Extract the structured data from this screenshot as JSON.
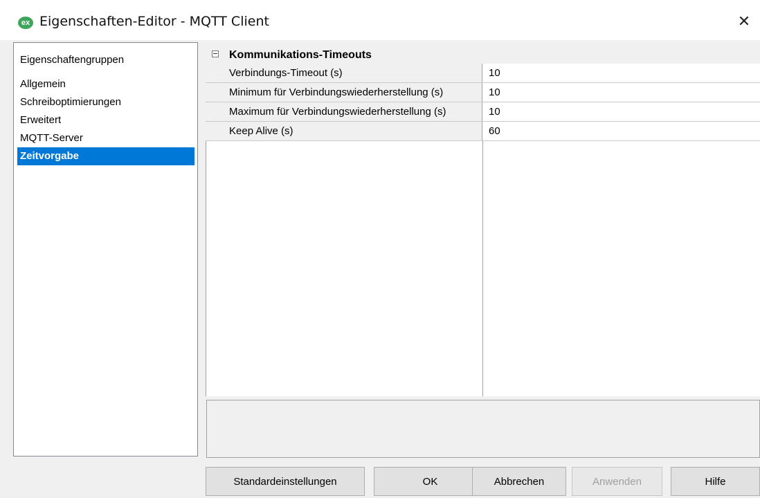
{
  "window": {
    "title": "Eigenschaften-Editor - MQTT Client",
    "icon_text": "ex",
    "icon_name": "app-ex-icon",
    "close_glyph": "✕"
  },
  "sidebar": {
    "header": "Eigenschaftengruppen",
    "items": [
      {
        "label": "Allgemein",
        "selected": false
      },
      {
        "label": "Schreiboptimierungen",
        "selected": false
      },
      {
        "label": "Erweitert",
        "selected": false
      },
      {
        "label": "MQTT-Server",
        "selected": false
      },
      {
        "label": "Zeitvorgabe",
        "selected": true
      }
    ]
  },
  "property_grid": {
    "category": {
      "label": "Kommunikations-Timeouts",
      "expanded": true
    },
    "rows": [
      {
        "name": "Verbindungs-Timeout (s)",
        "value": "10"
      },
      {
        "name": "Minimum für Verbindungswiederherstellung (s)",
        "value": "10"
      },
      {
        "name": "Maximum für Verbindungswiederherstellung (s)",
        "value": "10"
      },
      {
        "name": "Keep Alive (s)",
        "value": "60"
      }
    ]
  },
  "buttons": {
    "defaults": "Standardeinstellungen",
    "ok": "OK",
    "cancel": "Abbrechen",
    "apply": "Anwenden",
    "help": "Hilfe"
  },
  "colors": {
    "selection": "#0078d7",
    "background": "#f0f0f0"
  }
}
